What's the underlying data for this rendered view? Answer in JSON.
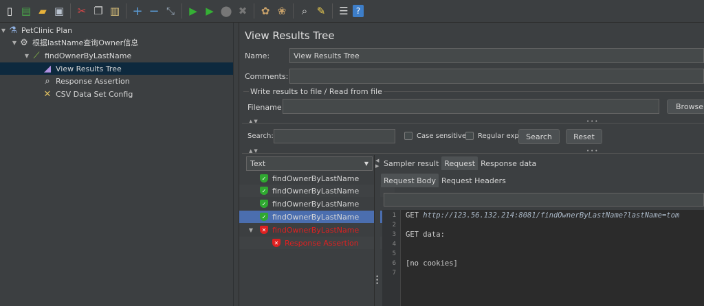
{
  "toolbar": {
    "icons": [
      "new-icon",
      "templates-icon",
      "open-icon",
      "save-icon",
      "cut-icon",
      "copy-icon",
      "paste-icon",
      "expand-icon",
      "collapse-icon",
      "toggle-icon",
      "start-icon",
      "start-no-pause-icon",
      "stop-icon",
      "shutdown-icon",
      "clear-icon",
      "clear-all-icon",
      "search-icon",
      "reset-search-icon",
      "function-helper-icon",
      "help-icon"
    ]
  },
  "tree": {
    "items": [
      {
        "label": "PetClinic Plan",
        "icon": "test-plan-icon"
      },
      {
        "label": "根据lastName查询Owner信息",
        "icon": "thread-group-icon"
      },
      {
        "label": "findOwnerByLastName",
        "icon": "sampler-icon"
      },
      {
        "label": "View Results Tree",
        "icon": "listener-icon"
      },
      {
        "label": "Response Assertion",
        "icon": "assertion-icon"
      },
      {
        "label": "CSV Data Set Config",
        "icon": "config-element-icon"
      }
    ]
  },
  "panel": {
    "title": "View Results Tree",
    "name_label": "Name:",
    "name_value": "View Results Tree",
    "comments_label": "Comments:",
    "file_section_label": "Write results to file / Read from file",
    "filename_label": "Filename",
    "browse_label": "Browse...",
    "search_label": "Search:",
    "case_sensitive_label": "Case sensitive",
    "regular_exp_label": "Regular exp.",
    "search_button": "Search",
    "reset_button": "Reset"
  },
  "renderer": {
    "selected": "Text"
  },
  "results": [
    {
      "label": "findOwnerByLastName",
      "status": "pass"
    },
    {
      "label": "findOwnerByLastName",
      "status": "pass"
    },
    {
      "label": "findOwnerByLastName",
      "status": "pass"
    },
    {
      "label": "findOwnerByLastName",
      "status": "pass"
    },
    {
      "label": "findOwnerByLastName",
      "status": "fail"
    },
    {
      "label": "Response Assertion",
      "status": "fail"
    }
  ],
  "tabs": {
    "main": [
      "Sampler result",
      "Request",
      "Response data"
    ],
    "sub": [
      "Request Body",
      "Request Headers"
    ]
  },
  "editor": {
    "line_numbers": [
      "1",
      "2",
      "3",
      "4",
      "5",
      "6",
      "7"
    ],
    "line1_method": "GET ",
    "line1_url": "http://123.56.132.214:8081/findOwnerByLastName?lastName=tom",
    "line3": "GET data:",
    "line6": "[no cookies]"
  },
  "colors": {
    "pass": "#2fa830",
    "fail": "#e02020",
    "selection": "#4b6eaf"
  }
}
